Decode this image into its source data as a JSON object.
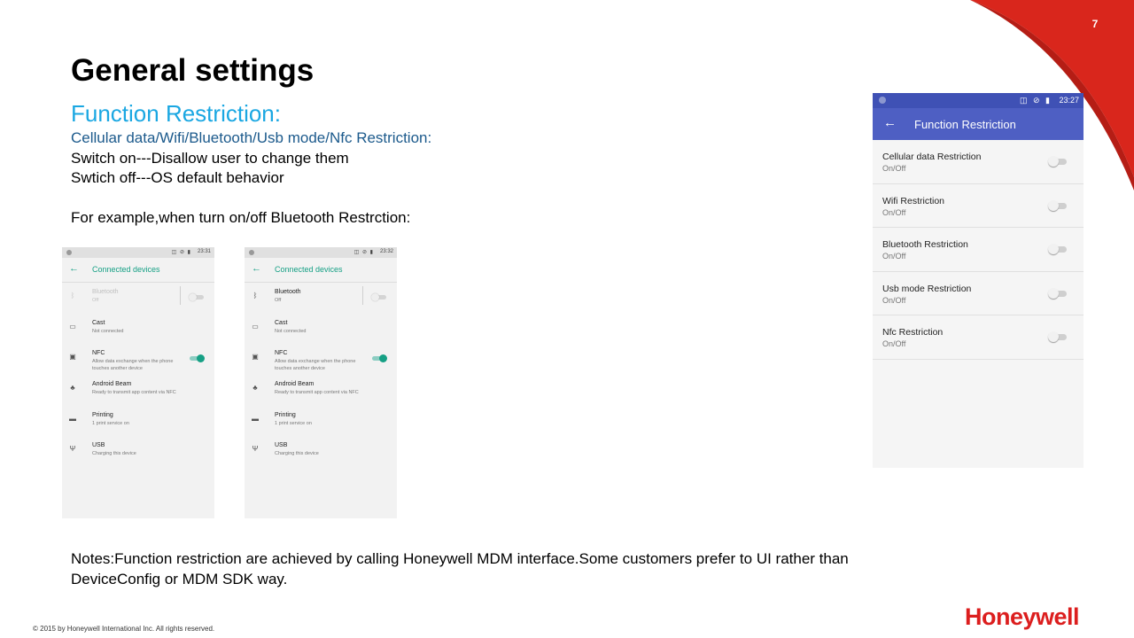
{
  "slide": {
    "number": "7",
    "title": "General settings",
    "subtitle": "Function Restriction:",
    "restriction_list": "Cellular data/Wifi/Bluetooth/Usb mode/Nfc Restriction:",
    "line_on": "Switch on---Disallow user to change them",
    "line_off": "Swtich off---OS default behavior",
    "example": "For example,when turn on/off Bluetooth Restrction:",
    "notes": "Notes:Function restriction are achieved by calling Honeywell MDM interface.Some customers prefer to UI rather than DeviceConfig or MDM SDK way.",
    "copyright": "© 2015  by Honeywell International Inc. All rights reserved.",
    "logo": "Honeywell",
    "colors": {
      "accent_blue": "#1aa7e2",
      "dark_blue": "#1c5a8c",
      "brand_red": "#dc1e1e",
      "teal": "#16a085",
      "indigo": "#4e5fc3"
    }
  },
  "phone1": {
    "time": "23:31",
    "title": "Connected devices",
    "rows": [
      {
        "icon": "bluetooth-icon",
        "title": "Bluetooth",
        "sub": "Off"
      },
      {
        "icon": "cast-icon",
        "title": "Cast",
        "sub": "Not connected"
      },
      {
        "icon": "nfc-icon",
        "title": "NFC",
        "sub": "Allow data exchange when the phone touches another device"
      },
      {
        "icon": "android-icon",
        "title": "Android Beam",
        "sub": "Ready to transmit app content via NFC"
      },
      {
        "icon": "printer-icon",
        "title": "Printing",
        "sub": "1 print service on"
      },
      {
        "icon": "usb-icon",
        "title": "USB",
        "sub": "Charging this device"
      }
    ]
  },
  "phone2": {
    "time": "23:32",
    "title": "Connected devices",
    "rows": [
      {
        "icon": "bluetooth-icon",
        "title": "Bluetooth",
        "sub": "Off"
      },
      {
        "icon": "cast-icon",
        "title": "Cast",
        "sub": "Not connected"
      },
      {
        "icon": "nfc-icon",
        "title": "NFC",
        "sub": "Allow data exchange when the phone touches another device"
      },
      {
        "icon": "android-icon",
        "title": "Android Beam",
        "sub": "Ready to transmit app content via NFC"
      },
      {
        "icon": "printer-icon",
        "title": "Printing",
        "sub": "1 print service on"
      },
      {
        "icon": "usb-icon",
        "title": "USB",
        "sub": "Charging this device"
      }
    ]
  },
  "phone3": {
    "time": "23:27",
    "title": "Function Restriction",
    "rows": [
      {
        "title": "Cellular data Restriction",
        "sub": "On/Off"
      },
      {
        "title": "Wifi Restriction",
        "sub": "On/Off"
      },
      {
        "title": "Bluetooth Restriction",
        "sub": "On/Off"
      },
      {
        "title": "Usb mode Restriction",
        "sub": "On/Off"
      },
      {
        "title": "Nfc Restriction",
        "sub": "On/Off"
      }
    ]
  }
}
